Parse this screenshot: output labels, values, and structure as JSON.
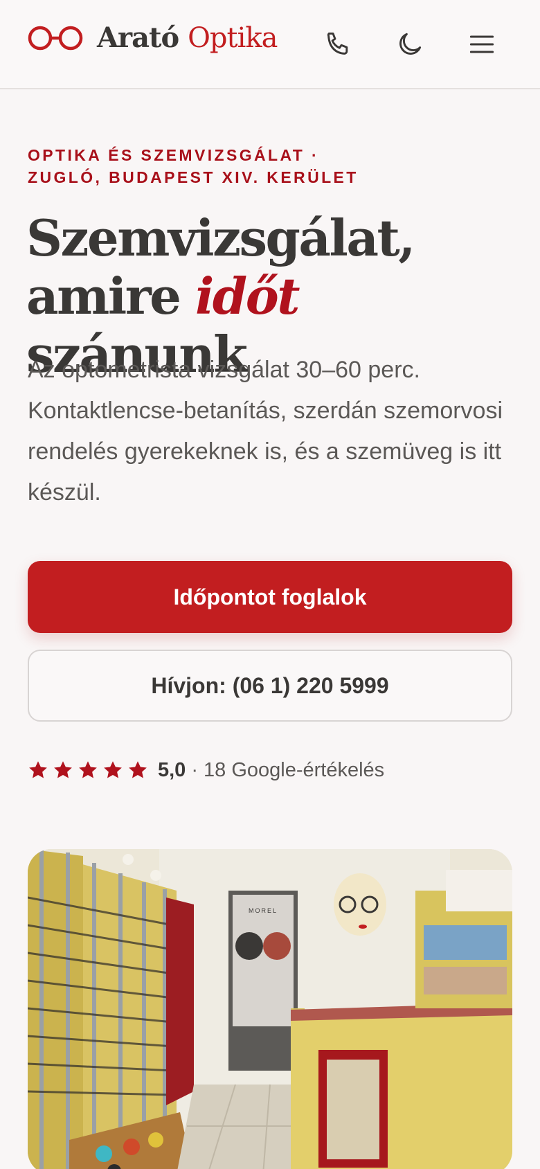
{
  "brand": {
    "name_part1": "Arató",
    "name_part2": "Optika",
    "primary_color": "#c21e20",
    "accent_color": "#b0121d"
  },
  "header": {
    "icons": [
      "phone-icon",
      "moon-icon",
      "menu-icon"
    ]
  },
  "hero": {
    "eyebrow_line1": "OPTIKA ÉS SZEMVIZSGÁLAT ·",
    "eyebrow_line2": "ZUGLÓ, BUDAPEST XIV. KERÜLET",
    "headline_line1": "Szemvizsgálat,",
    "headline_pre": "amire",
    "headline_accent": "időt",
    "headline_post": "szánunk",
    "lead": "Az optometrista vizsgálat 30–60 perc. Kontaktlencse-betanítás, szerdán szemorvosi rendelés gyerekeknek is, és a szemüveg is itt készül.",
    "primary_button": "Időpontot foglalok",
    "secondary_button": "Hívjon: (06 1) 220 5999"
  },
  "rating": {
    "stars": 5,
    "score": "5,0",
    "separator": "·",
    "reviews": "18 Google-értékelés"
  },
  "photo": {
    "poster_brand": "MOREL"
  }
}
